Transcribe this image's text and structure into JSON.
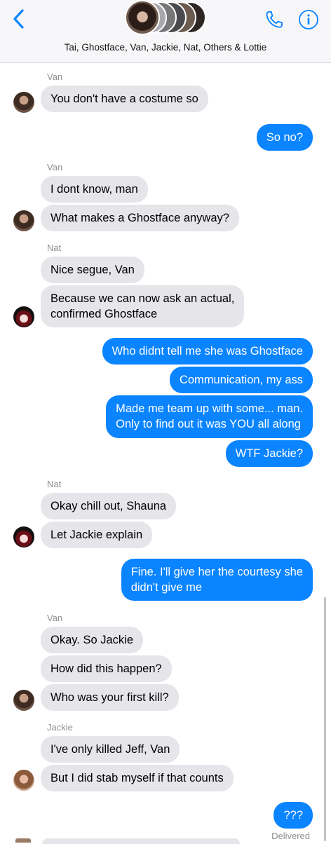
{
  "header": {
    "title": "Tai, Ghostface, Van, Jackie, Nat, Others & Lottie",
    "stack_colors": [
      "#a9a9ad",
      "#777779",
      "#4a4a4c",
      "#6b5a50",
      "#2e2624"
    ],
    "accent": "#0b84ff"
  },
  "colors": {
    "outgoing": "#0b84ff",
    "incoming": "#e5e5ea",
    "muted": "#8e8e93"
  },
  "messages": {
    "name_van_1": "Van",
    "m1": "You don't have a costume so",
    "m2": "So no?",
    "name_van_2": "Van",
    "m3": "I dont know, man",
    "m4": "What makes a Ghostface anyway?",
    "name_nat_1": "Nat",
    "m5": "Nice segue, Van",
    "m6": "Because we can now ask an actual,\nconfirmed Ghostface",
    "m7": "Who didnt tell me she was Ghostface",
    "m8": "Communication, my ass",
    "m9": "Made me team up with some... man.\nOnly to find out it was YOU all along",
    "m10": "WTF Jackie?",
    "name_nat_2": "Nat",
    "m11": "Okay chill out, Shauna",
    "m12": "Let Jackie explain",
    "m13": "Fine. I'll give her the courtesy she\ndidn't give me",
    "name_van_3": "Van",
    "m14": "Okay. So Jackie",
    "m15": "How did this happen?",
    "m16": "Who was your first kill?",
    "name_jackie_1": "Jackie",
    "m17": "I've only killed Jeff, Van",
    "m18": "But I did stab myself if that counts",
    "m19": "???",
    "delivered": "Delivered"
  }
}
